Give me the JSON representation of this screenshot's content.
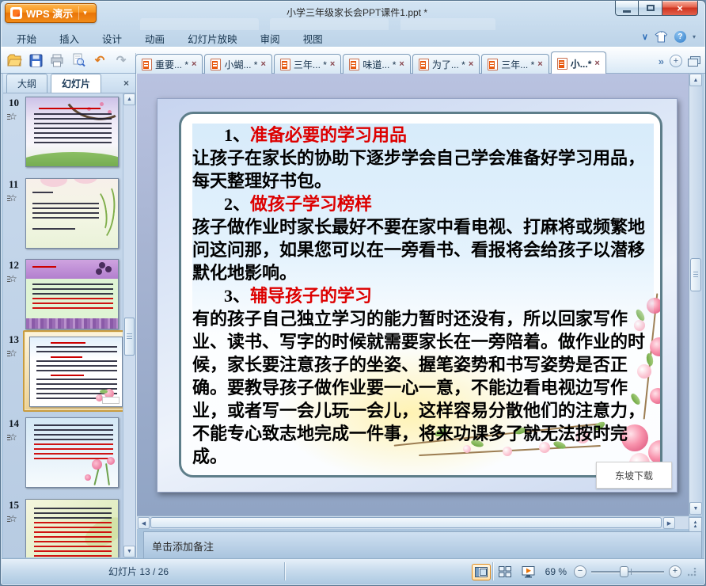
{
  "window": {
    "app_button": "WPS 演示",
    "title": "小学三年级家长会PPT课件1.ppt *"
  },
  "menu": {
    "items": [
      "开始",
      "插入",
      "设计",
      "动画",
      "幻灯片放映",
      "审阅",
      "视图"
    ]
  },
  "toolbar": {
    "tabs": [
      {
        "label": "重要... *"
      },
      {
        "label": "小蝴... *"
      },
      {
        "label": "三年... *"
      },
      {
        "label": "味道... *"
      },
      {
        "label": "为了... *"
      },
      {
        "label": "三年... *"
      },
      {
        "label": "小...*"
      }
    ]
  },
  "sidebar": {
    "tabs": [
      "大纲",
      "幻灯片"
    ],
    "active_tab": "幻灯片",
    "slides": [
      {
        "num": "10"
      },
      {
        "num": "11"
      },
      {
        "num": "12"
      },
      {
        "num": "13"
      },
      {
        "num": "14"
      },
      {
        "num": "15"
      }
    ],
    "selected_num": "13"
  },
  "slide": {
    "sections": [
      {
        "num": "1、",
        "title": "准备必要的学习用品",
        "body": "让孩子在家长的协助下逐步学会自己学会准备好学习用品，每天整理好书包。"
      },
      {
        "num": "2、",
        "title": "做孩子学习榜样",
        "body": "孩子做作业时家长最好不要在家中看电视、打麻将或频繁地问这问那，如果您可以在一旁看书、看报将会给孩子以潜移默化地影响。"
      },
      {
        "num": "3、",
        "title": "辅导孩子的学习",
        "body": "有的孩子自己独立学习的能力暂时还没有，所以回家写作业、读书、写字的时候就需要家长在一旁陪着。做作业的时候，家长要注意孩子的坐姿、握笔姿势和书写姿势是否正确。要教导孩子做作业要一心一意，不能边看电视边写作业，或者写一会儿玩一会儿，这样容易分散他们的注意力，不能专心致志地完成一件事，将来功课多了就无法按时完成。"
      }
    ],
    "watermark": "东坡下载"
  },
  "notes": {
    "placeholder": "单击添加备注"
  },
  "statusbar": {
    "slide_indicator": "幻灯片 13 / 26",
    "zoom": "69 %"
  },
  "icons": {
    "close": "×",
    "dropdown": "▾",
    "collapse": "∨",
    "help": "?",
    "chevron_left": "«",
    "chevron_right": "»",
    "more": "▼",
    "undo": "↶",
    "redo": "↷",
    "up": "▲",
    "down": "▼",
    "left": "◀",
    "right": "▶",
    "star": "☆",
    "minus": "−",
    "plus": "+"
  },
  "colors": {
    "accent_orange": "#e87408",
    "heading_red": "#dd0000",
    "selection_gold": "#c89b3f",
    "close_button_red": "#ce3420"
  }
}
